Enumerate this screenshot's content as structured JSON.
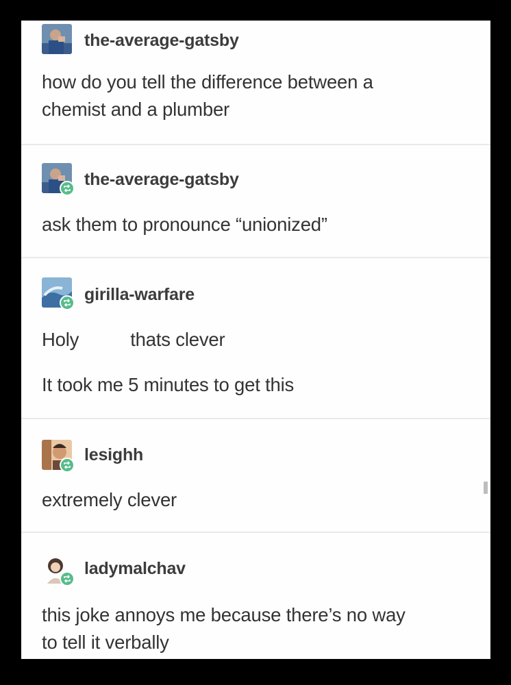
{
  "posts": [
    {
      "username": "the-average-gatsby",
      "avatar": "man-avatar",
      "reblog": false,
      "lines": [
        "how do you tell the difference between a",
        "chemist and a plumber"
      ]
    },
    {
      "username": "the-average-gatsby",
      "avatar": "man-avatar",
      "reblog": true,
      "lines": [
        "ask them to pronounce “unionized”"
      ]
    },
    {
      "username": "girilla-warfare",
      "avatar": "wave-avatar",
      "reblog": true,
      "line1_a": "Holy",
      "line1_b": "thats clever",
      "line2": "It took me 5 minutes to get this"
    },
    {
      "username": "lesighh",
      "avatar": "cartoon-avatar",
      "reblog": true,
      "lines": [
        "extremely clever"
      ]
    },
    {
      "username": "ladymalchav",
      "avatar": "girl-avatar",
      "reblog": true,
      "lines": [
        "this joke annoys me because there’s no way",
        "to tell it verbally"
      ]
    }
  ],
  "colors": {
    "reblog": "#56bc8a",
    "text": "#333333",
    "background": "#fefefe",
    "frame": "#000000"
  }
}
